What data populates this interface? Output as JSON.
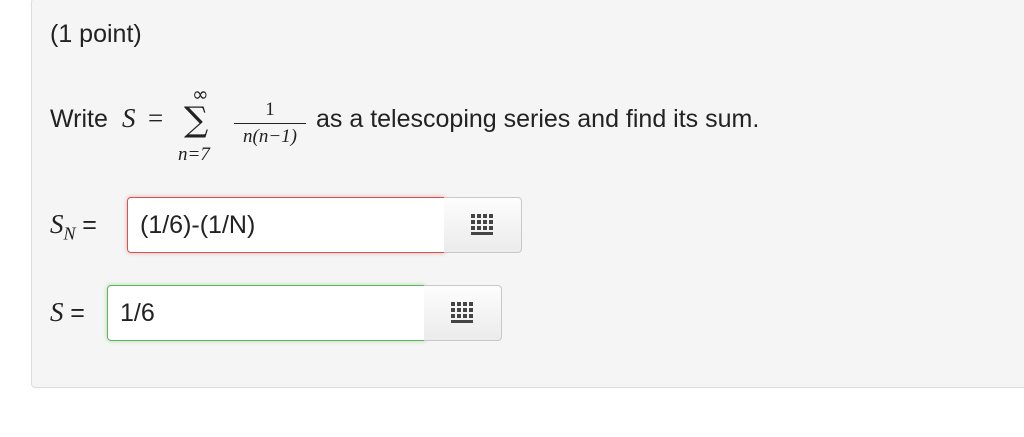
{
  "problem": {
    "points_label": "(1 point)",
    "prompt_prefix": "Write",
    "lhs_var": "S",
    "equals": "=",
    "sum_upper": "∞",
    "sum_symbol": "∑",
    "sum_lower": "n=7",
    "frac_numerator": "1",
    "frac_denominator": "n(n−1)",
    "prompt_suffix": "as a telescoping series and find its sum."
  },
  "answers": [
    {
      "label_var": "S",
      "label_sub": "N",
      "label_eq": "=",
      "value": "(1/6)-(1/N)",
      "status": "incorrect",
      "status_color": "#d9534f",
      "palette_icon": "equation-palette-grid-icon"
    },
    {
      "label_var": "S",
      "label_sub": "",
      "label_eq": "=",
      "value": "1/6",
      "status": "correct",
      "status_color": "#5cb85c",
      "palette_icon": "equation-palette-grid-icon"
    }
  ]
}
